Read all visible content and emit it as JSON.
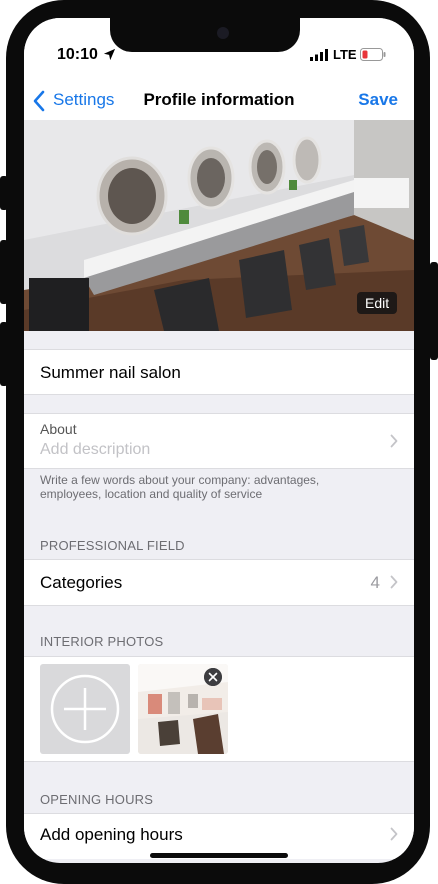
{
  "status": {
    "time": "10:10",
    "network": "LTE"
  },
  "nav": {
    "back_label": "Settings",
    "title": "Profile information",
    "save_label": "Save"
  },
  "cover": {
    "edit_label": "Edit"
  },
  "profile": {
    "company_name": "Summer nail salon"
  },
  "about": {
    "label": "About",
    "placeholder": "Add description",
    "helper": "Write a few words about your company: advantages, employees, location and quality of service"
  },
  "professional_field": {
    "header": "PROFESSIONAL FIELD",
    "categories_label": "Categories",
    "categories_count": "4"
  },
  "interior_photos": {
    "header": "INTERIOR PHOTOS"
  },
  "opening_hours": {
    "header": "OPENING HOURS",
    "add_label": "Add opening hours"
  },
  "colors": {
    "accent": "#1877e8",
    "background": "#efeff4",
    "battery_low": "#e8353a"
  },
  "icons": [
    "location-arrow-icon",
    "signal-icon",
    "battery-icon",
    "chevron-left-icon",
    "chevron-right-icon",
    "plus-icon",
    "close-icon"
  ]
}
